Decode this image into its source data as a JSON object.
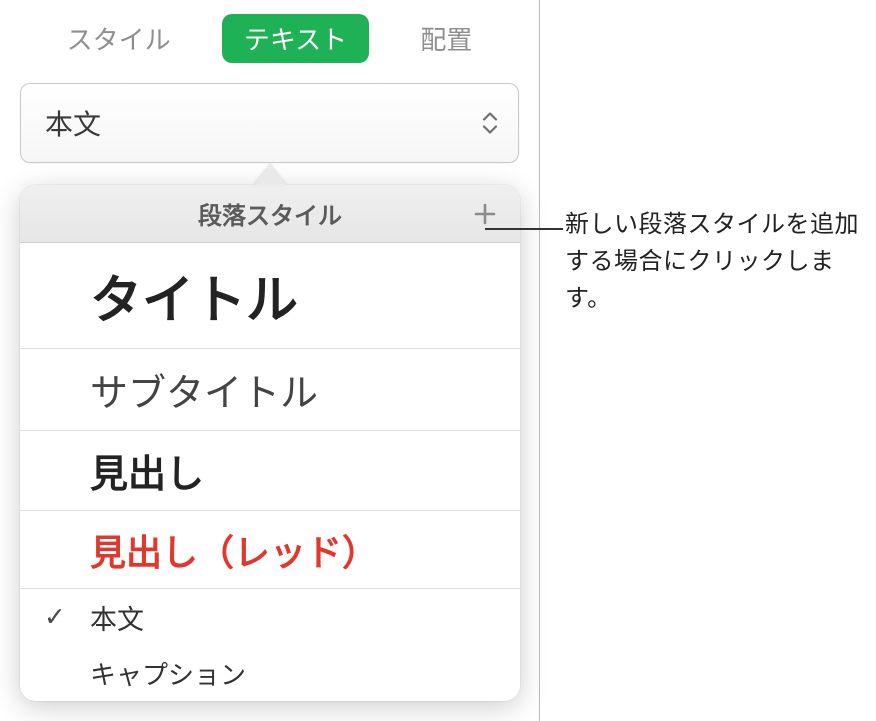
{
  "tabs": {
    "style": "スタイル",
    "text": "テキスト",
    "arrange": "配置"
  },
  "styleSelect": {
    "current": "本文"
  },
  "popover": {
    "header": "段落スタイル",
    "items": {
      "title": "タイトル",
      "subtitle": "サブタイトル",
      "heading": "見出し",
      "headingRed": "見出し（レッド）",
      "body": "本文",
      "caption": "キャプション"
    }
  },
  "callout": {
    "text": "新しい段落スタイルを追加する場合にクリックします。"
  }
}
